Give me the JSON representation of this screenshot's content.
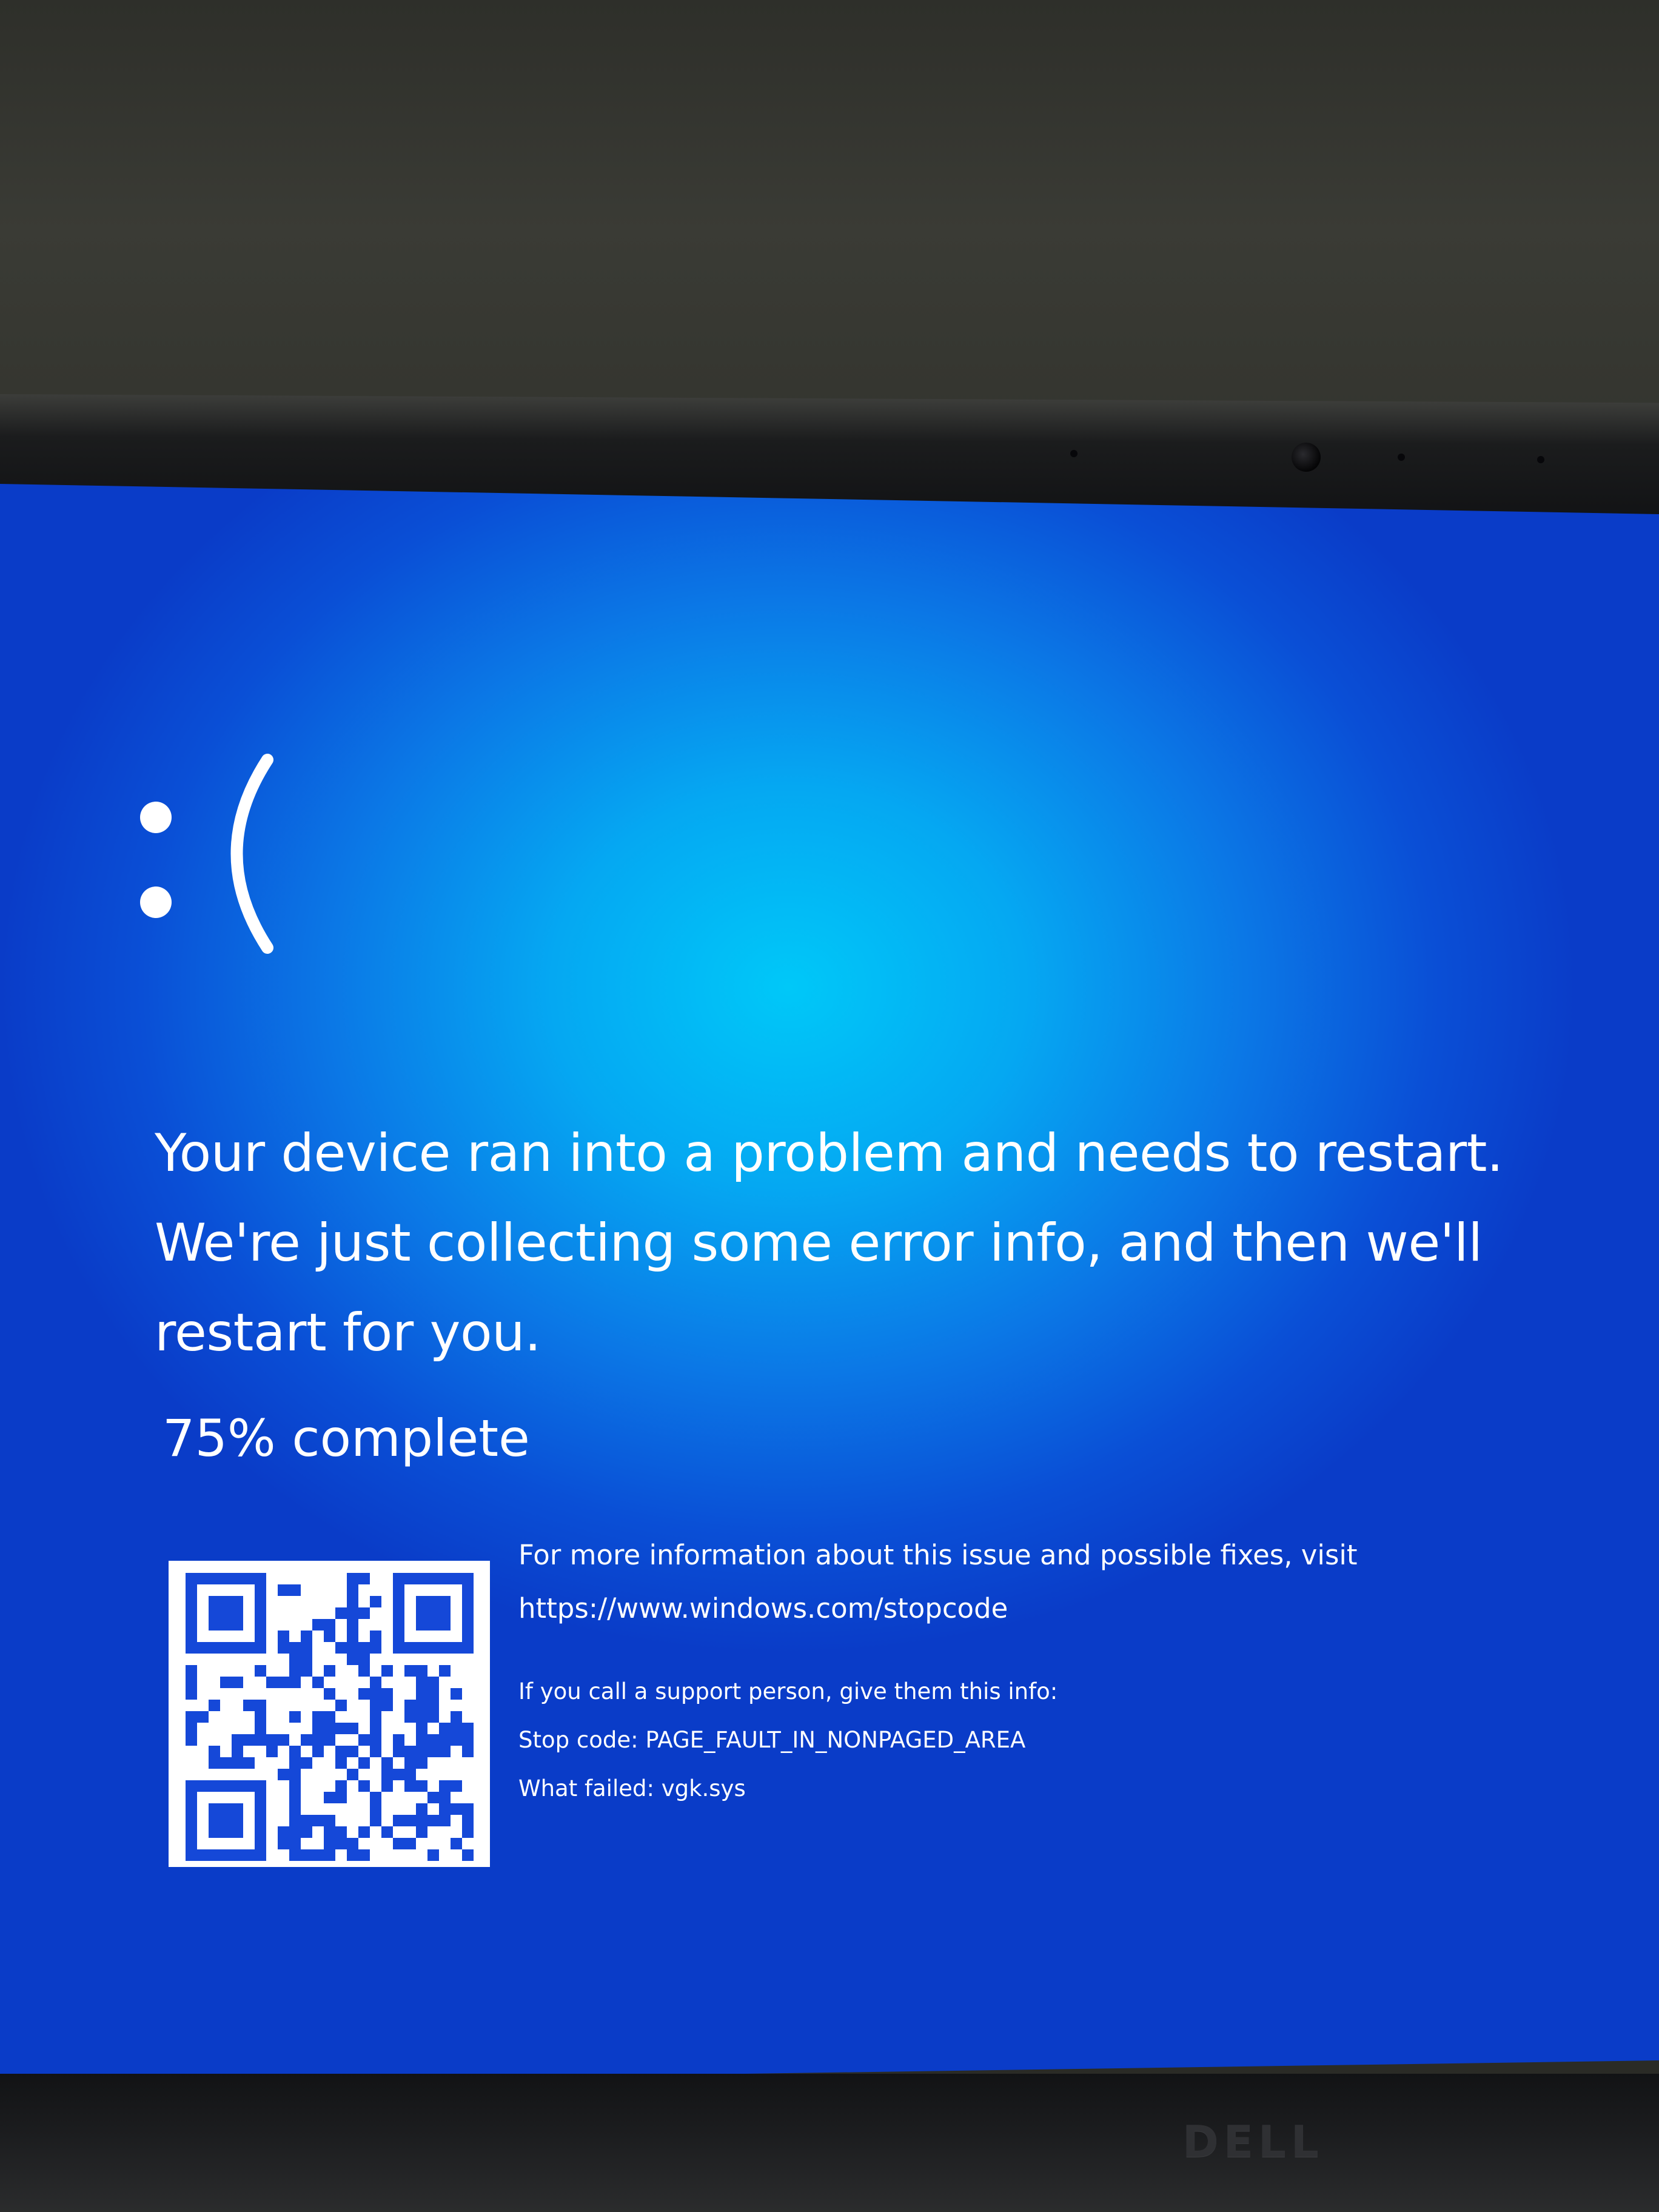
{
  "screen": {
    "face": ":(",
    "message_lines": [
      "Your device ran into a problem and needs to restart.",
      "We're just collecting some error info, and then we'll",
      "restart for you."
    ],
    "progress": {
      "percent": 75,
      "text": "75% complete"
    },
    "info": {
      "more_info": "For more information about this issue and possible fixes, visit",
      "url": "https://www.windows.com/stopcode",
      "support": "If you call a support person, give them this info:",
      "stop_code": "Stop code: PAGE_FAULT_IN_NONPAGED_AREA",
      "what_failed": "What failed: vgk.sys"
    }
  },
  "device": {
    "logo_text": "DELL"
  },
  "colors": {
    "screen_blue": "#0a78e6",
    "screen_glow": "#00c8f8",
    "qr_blue": "#1548d8",
    "text": "#ffffff",
    "bezel": "#15161a"
  },
  "icons": {
    "face": "sad-face-icon",
    "qr": "qr-code-icon",
    "webcam": "webcam-icon"
  }
}
